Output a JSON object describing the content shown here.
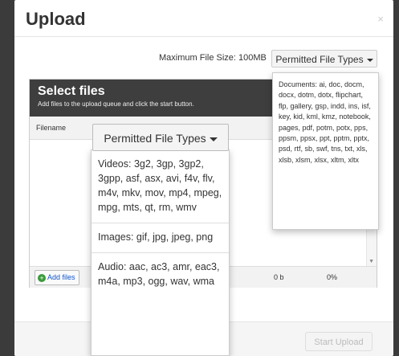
{
  "modal": {
    "title": "Upload",
    "close_glyph": "×"
  },
  "toolbar": {
    "max_size_label": "Maximum File Size: 100MB",
    "permitted_types_label": "Permitted File Types"
  },
  "uploader": {
    "title": "Select files",
    "subtitle": "Add files to the upload queue and click the start button.",
    "column_filename": "Filename",
    "add_files_label": "Add files",
    "add_icon": "plus-circle-icon",
    "total_size": "0 b",
    "total_percent": "0%"
  },
  "dropdown_top": {
    "documents": "Documents: ai, doc, docm, docx, dotm, dotx, flipchart, flp, gallery, gsp, indd, ins, isf, key, kid, kml, kmz, notebook, pages, pdf, potm, potx, pps, ppsm, ppsx, ppt, pptm, pptx, psd, rtf, sb, swf, tns, txt, xls, xlsb, xlsm, xlsx, xltm, xltx"
  },
  "dropdown_main": {
    "button_label": "Permitted File Types",
    "videos": "Videos: 3g2, 3gp, 3gp2, 3gpp, asf, asx, avi, f4v, flv, m4v, mkv, mov, mp4, mpeg, mpg, mts, qt, rm, wmv",
    "images": "Images: gif, jpg, jpeg, png",
    "audio": "Audio: aac, ac3, amr, eac3, m4a, mp3, ogg, wav, wma"
  },
  "footer": {
    "start_upload_label": "Start Upload"
  },
  "colors": {
    "header_dark": "#3e3e3e",
    "add_icon_green": "#3a9a3a",
    "link_blue": "#15c"
  }
}
